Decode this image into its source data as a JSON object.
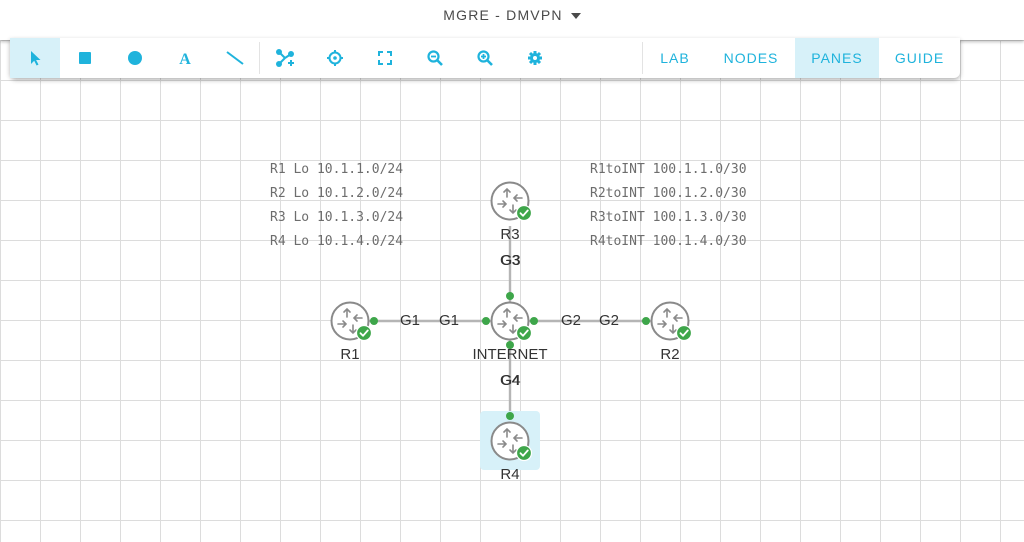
{
  "lab": {
    "title": "MGRE - DMVPN"
  },
  "toolbar": {
    "tools": [
      {
        "icon": "pointer-icon",
        "active": true
      },
      {
        "icon": "rectangle-icon"
      },
      {
        "icon": "ellipse-icon"
      },
      {
        "icon": "text-icon",
        "glyph": "A"
      },
      {
        "icon": "line-icon"
      },
      {
        "icon": "add-node-icon"
      },
      {
        "icon": "crosshair-icon"
      },
      {
        "icon": "fit-screen-icon"
      },
      {
        "icon": "zoom-out-icon"
      },
      {
        "icon": "zoom-in-icon"
      },
      {
        "icon": "settings-icon"
      }
    ],
    "tabs": [
      "LAB",
      "NODES",
      "PANES",
      "GUIDE"
    ],
    "active_tab": "PANES",
    "accent_color": "#1fb3dc",
    "active_bg": "#d7f1f9"
  },
  "annotations": {
    "loopbacks": [
      "R1 Lo 10.1.1.0/24",
      "R2 Lo 10.1.2.0/24",
      "R3 Lo 10.1.3.0/24",
      "R4 Lo 10.1.4.0/24"
    ],
    "links": [
      "R1toINT 100.1.1.0/30",
      "R2toINT 100.1.2.0/30",
      "R3toINT 100.1.3.0/30",
      "R4toINT 100.1.4.0/30"
    ]
  },
  "topology": {
    "nodes": [
      {
        "id": "r3",
        "label": "R3",
        "status": "running",
        "selected": false
      },
      {
        "id": "r1",
        "label": "R1",
        "status": "running",
        "selected": false
      },
      {
        "id": "internet",
        "label": "INTERNET",
        "status": "running",
        "selected": false
      },
      {
        "id": "r2",
        "label": "R2",
        "status": "running",
        "selected": false
      },
      {
        "id": "r4",
        "label": "R4",
        "status": "running",
        "selected": true
      }
    ],
    "links": [
      {
        "from": "r3",
        "to": "internet",
        "labels": [
          "G3",
          "G3"
        ]
      },
      {
        "from": "r1",
        "to": "internet",
        "labels": [
          "G1",
          "G1"
        ]
      },
      {
        "from": "internet",
        "to": "r2",
        "labels": [
          "G2",
          "G2"
        ]
      },
      {
        "from": "internet",
        "to": "r4",
        "labels": [
          "G4",
          "G4"
        ]
      }
    ],
    "status_color": "#3ea64a",
    "link_color": "#b5b5b5"
  }
}
